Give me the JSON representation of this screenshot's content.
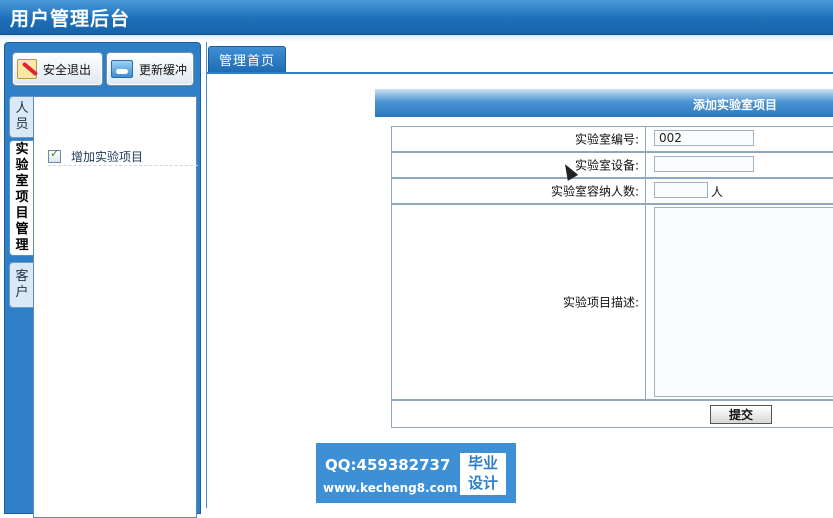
{
  "header": {
    "title": "用户管理后台"
  },
  "toolbar": {
    "logout_label": "安全退出",
    "refresh_label": "更新缓冲"
  },
  "side_tabs": [
    {
      "label": "人员"
    },
    {
      "label": "实验室项目管理"
    },
    {
      "label": "客户"
    }
  ],
  "tree": {
    "item_label": "增加实验项目"
  },
  "main": {
    "tab_home": "管理首页",
    "form_title": "添加实验室项目",
    "fields": {
      "id_label": "实验室编号:",
      "id_value": "002",
      "device_label": "实验室设备:",
      "device_value": "",
      "capacity_label": "实验室容纳人数:",
      "capacity_value": "",
      "capacity_unit": "人",
      "desc_label": "实验项目描述:"
    },
    "submit_label": "提交"
  },
  "watermark": {
    "qq": "QQ:459382737",
    "url": "www.kecheng8.com",
    "badge_line1": "毕业",
    "badge_line2": "设计"
  },
  "colors": {
    "header_blue": "#1d6fb8",
    "panel_blue": "#2f7fc6",
    "watermark_blue": "#3d8fd6"
  }
}
